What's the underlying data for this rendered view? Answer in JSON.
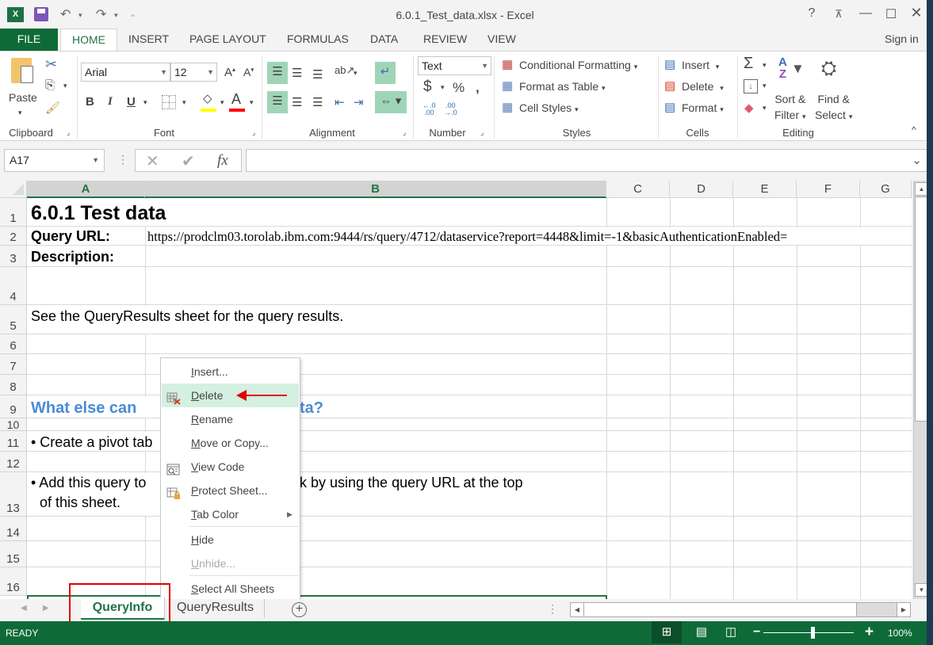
{
  "window": {
    "title": "6.0.1_Test_data.xlsx - Excel",
    "help": "?",
    "sign_in": "Sign in"
  },
  "ribbon_tabs": [
    "FILE",
    "HOME",
    "INSERT",
    "PAGE LAYOUT",
    "FORMULAS",
    "DATA",
    "REVIEW",
    "VIEW"
  ],
  "ribbon": {
    "clipboard": {
      "paste": "Paste",
      "label": "Clipboard"
    },
    "font": {
      "name": "Arial",
      "size": "12",
      "bold": "B",
      "italic": "I",
      "underline": "U",
      "label": "Font",
      "fill_color": "#ffff00",
      "font_color": "#ff0000"
    },
    "alignment": {
      "label": "Alignment"
    },
    "number": {
      "format": "Text",
      "currency": "$",
      "percent": "%",
      "comma": ",",
      "label": "Number"
    },
    "styles": {
      "conditional": "Conditional Formatting",
      "format_table": "Format as Table",
      "cell_styles": "Cell Styles",
      "label": "Styles"
    },
    "cells": {
      "insert": "Insert",
      "delete": "Delete",
      "format": "Format",
      "label": "Cells"
    },
    "editing": {
      "sort": "Sort &",
      "sort2": "Filter",
      "find": "Find &",
      "find2": "Select",
      "label": "Editing"
    }
  },
  "formula_bar": {
    "name_box": "A17",
    "fx": "fx",
    "value": ""
  },
  "columns": [
    "A",
    "B",
    "C",
    "D",
    "E",
    "F",
    "G"
  ],
  "rows": [
    "1",
    "2",
    "3",
    "4",
    "5",
    "6",
    "7",
    "8",
    "9",
    "10",
    "11",
    "12",
    "13",
    "14",
    "15",
    "16"
  ],
  "cells": {
    "a1": "6.0.1 Test data",
    "a2": "Query URL:",
    "b2": "https://prodclm03.torolab.ibm.com:9444/rs/query/4712/dataservice?report=4448&limit=-1&basicAuthenticationEnabled=",
    "a3": "Description:",
    "a5": "See the QueryResults sheet for the query results.",
    "a9": "What else can",
    "a9_tail": "ta?",
    "a11": "• Create a pivot tab",
    "a13": "• Add this query to",
    "a13_tail": "k by using the query URL at the top",
    "a13_line2": "of this sheet."
  },
  "context_menu": [
    {
      "label": "Insert...",
      "key": "I",
      "rest": "nsert..."
    },
    {
      "label": "Delete",
      "key": "D",
      "rest": "elete",
      "highlighted": true
    },
    {
      "label": "Rename",
      "key": "R",
      "rest": "ename"
    },
    {
      "label": "Move or Copy...",
      "key": "M",
      "rest": "ove or Copy..."
    },
    {
      "label": "View Code",
      "key": "V",
      "rest": "iew Code"
    },
    {
      "label": "Protect Sheet...",
      "key": "P",
      "rest": "rotect Sheet..."
    },
    {
      "label": "Tab Color",
      "key": "T",
      "rest": "ab Color"
    },
    {
      "label": "Hide",
      "key": "H",
      "rest": "ide"
    },
    {
      "label": "Unhide...",
      "key": "U",
      "rest": "nhide...",
      "disabled": true
    },
    {
      "label": "Select All Sheets",
      "key": "S",
      "rest": "elect All Sheets"
    }
  ],
  "sheets": [
    {
      "name": "QueryInfo",
      "active": true
    },
    {
      "name": "QueryResults",
      "active": false
    }
  ],
  "status": {
    "text": "READY",
    "zoom": "100%",
    "zoom_level_percent": 100
  },
  "colors": {
    "accent": "#217346",
    "status_bar": "#0e6b38",
    "heading_blue": "#4a8bd6",
    "annotation_red": "#e00000"
  }
}
